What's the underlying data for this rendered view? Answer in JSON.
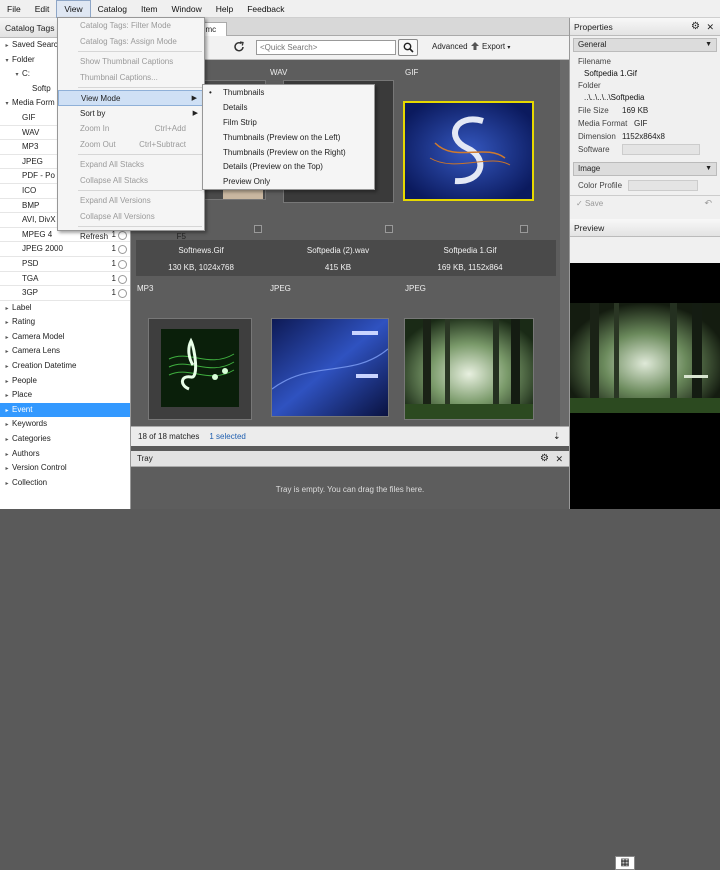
{
  "menubar": [
    "File",
    "Edit",
    "View",
    "Catalog",
    "Item",
    "Window",
    "Help",
    "Feedback"
  ],
  "left_panel": {
    "title": "Catalog Tags",
    "rows": [
      {
        "label": "Saved Searc",
        "indent": 0,
        "tri": "▸"
      },
      {
        "label": "Folder",
        "indent": 0,
        "tri": "▾"
      },
      {
        "label": "C:",
        "indent": 1,
        "tri": "▾"
      },
      {
        "label": "Softp",
        "indent": 2,
        "tri": ""
      },
      {
        "label": "Media Form",
        "indent": 0,
        "tri": "▾"
      },
      {
        "label": "GIF",
        "indent": 1,
        "tri": "",
        "media": true
      },
      {
        "label": "WAV",
        "indent": 1,
        "tri": "",
        "media": true
      },
      {
        "label": "MP3",
        "indent": 1,
        "tri": "",
        "media": true
      },
      {
        "label": "JPEG",
        "indent": 1,
        "tri": "",
        "media": true
      },
      {
        "label": "PDF - Po",
        "indent": 1,
        "tri": "",
        "media": true
      },
      {
        "label": "ICO",
        "indent": 1,
        "tri": "",
        "media": true
      },
      {
        "label": "BMP",
        "indent": 1,
        "tri": "",
        "media": true
      },
      {
        "label": "AVI, DivX",
        "indent": 1,
        "tri": "",
        "media": true
      },
      {
        "label": "MPEG 4",
        "indent": 1,
        "tri": "",
        "count": "1",
        "media": true
      },
      {
        "label": "JPEG 2000",
        "indent": 1,
        "tri": "",
        "count": "1",
        "media": true
      },
      {
        "label": "PSD",
        "indent": 1,
        "tri": "",
        "count": "1",
        "media": true
      },
      {
        "label": "TGA",
        "indent": 1,
        "tri": "",
        "count": "1",
        "media": true
      },
      {
        "label": "3GP",
        "indent": 1,
        "tri": "",
        "count": "1",
        "media": true
      },
      {
        "label": "Label",
        "indent": 0,
        "tri": "▸"
      },
      {
        "label": "Rating",
        "indent": 0,
        "tri": "▸"
      },
      {
        "label": "Camera Model",
        "indent": 0,
        "tri": "▸"
      },
      {
        "label": "Camera Lens",
        "indent": 0,
        "tri": "▸"
      },
      {
        "label": "Creation Datetime",
        "indent": 0,
        "tri": "▸"
      },
      {
        "label": "People",
        "indent": 0,
        "tri": "▸"
      },
      {
        "label": "Place",
        "indent": 0,
        "tri": "▸"
      },
      {
        "label": "Event",
        "indent": 0,
        "tri": "▸",
        "selected": true
      },
      {
        "label": "Keywords",
        "indent": 0,
        "tri": "▸"
      },
      {
        "label": "Categories",
        "indent": 0,
        "tri": "▸"
      },
      {
        "label": "Authors",
        "indent": 0,
        "tri": "▸"
      },
      {
        "label": "Version Control",
        "indent": 0,
        "tri": "▸"
      },
      {
        "label": "Collection",
        "indent": 0,
        "tri": "▸"
      }
    ]
  },
  "tab": {
    "label": "dmc"
  },
  "toolbar": {
    "search_placeholder": "<Quick Search>",
    "advanced": "Advanced",
    "export": "Export"
  },
  "grid": {
    "row1": [
      {
        "type": "",
        "name": "Softnews.Gif",
        "info": "130 KB, 1024x768"
      },
      {
        "type": "WAV",
        "name": "Softpedia (2).wav",
        "info": "415 KB"
      },
      {
        "type": "GIF",
        "name": "Softpedia 1.Gif",
        "info": "169 KB, 1152x864"
      }
    ],
    "row2_types": [
      "MP3",
      "JPEG",
      "JPEG"
    ]
  },
  "status": {
    "matches": "18 of 18 matches",
    "selected": "1 selected"
  },
  "tray": {
    "title": "Tray",
    "empty_text": "Tray is empty. You can drag the files here."
  },
  "properties": {
    "title": "Properties",
    "general": "General",
    "filename_label": "Filename",
    "filename": "Softpedia 1.Gif",
    "folder_label": "Folder",
    "folder": "..\\..\\..\\..\\Softpedia",
    "filesize_label": "File Size",
    "filesize": "169 KB",
    "mediaformat_label": "Media Format",
    "mediaformat": "GIF",
    "dimension_label": "Dimension",
    "dimension": "1152x864x8",
    "software_label": "Software",
    "image": "Image",
    "colorprofile_label": "Color Profile",
    "save": "Save",
    "preview_title": "Preview"
  },
  "view_menu": [
    {
      "label": "Catalog Tags: Filter Mode",
      "disabled": true
    },
    {
      "label": "Catalog Tags: Assign Mode",
      "disabled": true
    },
    {
      "sep": true
    },
    {
      "label": "Show Thumbnail Captions",
      "disabled": true
    },
    {
      "label": "Thumbnail Captions...",
      "disabled": true
    },
    {
      "sep": true
    },
    {
      "label": "View Mode",
      "highlight": true,
      "submenu": true
    },
    {
      "label": "Sort by",
      "submenu": true
    },
    {
      "label": "Zoom In",
      "disabled": true,
      "shortcut": "Ctrl+Add"
    },
    {
      "label": "Zoom Out",
      "disabled": true,
      "shortcut": "Ctrl+Subtract"
    },
    {
      "sep": true
    },
    {
      "label": "Expand All Stacks",
      "disabled": true
    },
    {
      "label": "Collapse All Stacks",
      "disabled": true
    },
    {
      "sep": true
    },
    {
      "label": "Expand All Versions",
      "disabled": true
    },
    {
      "label": "Collapse All Versions",
      "disabled": true
    },
    {
      "sep": true
    },
    {
      "label": "Refresh",
      "shortcut": "F5"
    }
  ],
  "viewmode_menu": [
    {
      "label": "Thumbnails",
      "checked": true
    },
    {
      "label": "Details"
    },
    {
      "label": "Film Strip"
    },
    {
      "label": "Thumbnails (Preview on the Left)"
    },
    {
      "label": "Thumbnails (Preview on the Right)"
    },
    {
      "label": "Details (Preview on the Top)"
    },
    {
      "label": "Preview Only"
    }
  ],
  "colors": {
    "selection": "#3399ff",
    "highlight": "#cfe0f5",
    "grid_bg": "#5d5d5d"
  }
}
